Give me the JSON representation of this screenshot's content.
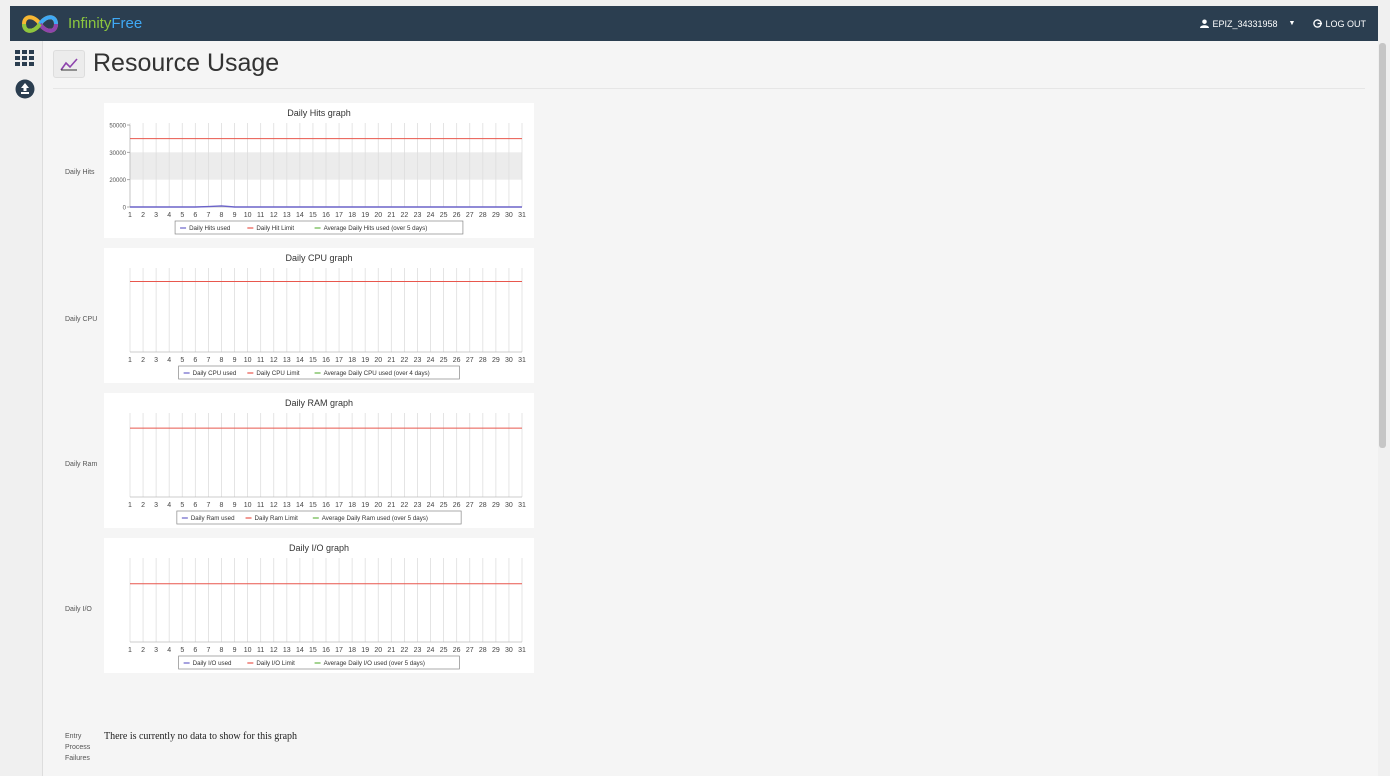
{
  "brand": {
    "part1": "Infinity",
    "part2": "Free"
  },
  "header": {
    "user": "EPIZ_34331958",
    "logout": "LOG OUT"
  },
  "page": {
    "title": "Resource Usage"
  },
  "colors": {
    "used": "#6b63c9",
    "limit": "#e8574d",
    "average": "#69b64a",
    "topbar": "#2b3e50"
  },
  "chart_data": [
    {
      "type": "line",
      "title": "Daily Hits graph",
      "ylabel": "Daily Hits",
      "x": [
        1,
        2,
        3,
        4,
        5,
        6,
        7,
        8,
        9,
        10,
        11,
        12,
        13,
        14,
        15,
        16,
        17,
        18,
        19,
        20,
        21,
        22,
        23,
        24,
        25,
        26,
        27,
        28,
        29,
        30,
        31
      ],
      "y_ticks": [
        "0",
        "20000",
        "40000",
        "60000"
      ],
      "y_tick_display": [
        "0",
        "20000",
        "30000",
        "50000"
      ],
      "ylim": [
        0,
        60000
      ],
      "band": [
        20000,
        40000
      ],
      "series": [
        {
          "name": "Daily Hits used",
          "role": "used",
          "values": [
            0,
            0,
            0,
            0,
            0,
            0,
            300,
            800,
            0,
            0,
            0,
            0,
            0,
            0,
            0,
            0,
            0,
            0,
            0,
            0,
            0,
            0,
            0,
            0,
            0,
            0,
            0,
            0,
            0,
            0,
            0
          ]
        },
        {
          "name": "Daily Hit Limit",
          "role": "limit",
          "values": [
            50000,
            50000,
            50000,
            50000,
            50000,
            50000,
            50000,
            50000,
            50000,
            50000,
            50000,
            50000,
            50000,
            50000,
            50000,
            50000,
            50000,
            50000,
            50000,
            50000,
            50000,
            50000,
            50000,
            50000,
            50000,
            50000,
            50000,
            50000,
            50000,
            50000,
            50000
          ]
        },
        {
          "name": "Average Daily Hits used (over 5 days)",
          "role": "average",
          "values": []
        }
      ]
    },
    {
      "type": "line",
      "title": "Daily CPU graph",
      "ylabel": "Daily CPU",
      "x": [
        1,
        2,
        3,
        4,
        5,
        6,
        7,
        8,
        9,
        10,
        11,
        12,
        13,
        14,
        15,
        16,
        17,
        18,
        19,
        20,
        21,
        22,
        23,
        24,
        25,
        26,
        27,
        28,
        29,
        30,
        31
      ],
      "limit_level": 0.86,
      "series": [
        {
          "name": "Daily CPU used",
          "role": "used",
          "values": []
        },
        {
          "name": "Daily CPU Limit",
          "role": "limit",
          "values": []
        },
        {
          "name": "Average Daily CPU used (over 4 days)",
          "role": "average",
          "values": []
        }
      ]
    },
    {
      "type": "line",
      "title": "Daily RAM graph",
      "ylabel": "Daily Ram",
      "x": [
        1,
        2,
        3,
        4,
        5,
        6,
        7,
        8,
        9,
        10,
        11,
        12,
        13,
        14,
        15,
        16,
        17,
        18,
        19,
        20,
        21,
        22,
        23,
        24,
        25,
        26,
        27,
        28,
        29,
        30,
        31
      ],
      "limit_level": 0.84,
      "series": [
        {
          "name": "Daily Ram used",
          "role": "used",
          "values": []
        },
        {
          "name": "Daily Ram Limit",
          "role": "limit",
          "values": []
        },
        {
          "name": "Average Daily Ram used  (over 5 days)",
          "role": "average",
          "values": []
        }
      ]
    },
    {
      "type": "line",
      "title": "Daily I/O graph",
      "ylabel": "Daily I/O",
      "x": [
        1,
        2,
        3,
        4,
        5,
        6,
        7,
        8,
        9,
        10,
        11,
        12,
        13,
        14,
        15,
        16,
        17,
        18,
        19,
        20,
        21,
        22,
        23,
        24,
        25,
        26,
        27,
        28,
        29,
        30,
        31
      ],
      "limit_level": 0.71,
      "series": [
        {
          "name": "Daily I/O used",
          "role": "used",
          "values": []
        },
        {
          "name": "Daily I/O Limit",
          "role": "limit",
          "values": []
        },
        {
          "name": "Average Daily I/O used (over 5 days)",
          "role": "average",
          "values": []
        }
      ]
    }
  ],
  "entry": {
    "label_lines": [
      "Entry",
      "Process",
      "Failures"
    ],
    "message": "There is currently no data to show for this graph"
  }
}
